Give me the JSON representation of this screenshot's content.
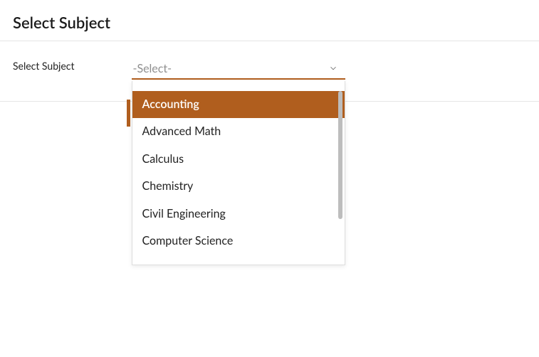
{
  "header": {
    "title": "Select Subject"
  },
  "form": {
    "label": "Select Subject",
    "placeholder": "-Select-"
  },
  "dropdown": {
    "options": [
      {
        "label": "Accounting",
        "highlighted": true
      },
      {
        "label": "Advanced Math",
        "highlighted": false
      },
      {
        "label": "Calculus",
        "highlighted": false
      },
      {
        "label": "Chemistry",
        "highlighted": false
      },
      {
        "label": "Civil Engineering",
        "highlighted": false
      },
      {
        "label": "Computer Science",
        "highlighted": false
      }
    ]
  },
  "colors": {
    "accent": "#b05e1e"
  }
}
